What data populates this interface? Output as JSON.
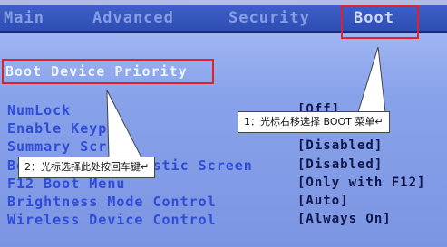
{
  "menubar": {
    "items": [
      {
        "label": "Main"
      },
      {
        "label": "Advanced"
      },
      {
        "label": "Security"
      },
      {
        "label": "Boot"
      }
    ]
  },
  "boot_device_priority": {
    "label": "Boot Device Priority"
  },
  "options": [
    {
      "label": "NumLock",
      "value": "[Off]"
    },
    {
      "label": "Enable Keypad",
      "value": ""
    },
    {
      "label": "Summary Screen",
      "value": "[Disabled]"
    },
    {
      "label": "Boot-time Diagnostic Screen",
      "value": "[Disabled]"
    },
    {
      "label": "F12 Boot Menu",
      "value": "[Only with F12]"
    },
    {
      "label": "Brightness Mode Control",
      "value": "[Auto]"
    },
    {
      "label": "Wireless Device Control",
      "value": "[Always On]"
    }
  ],
  "callouts": {
    "step1": "1：光标右移选择 BOOT 菜单↵",
    "step2": "2：光标选择此处按回车键↵"
  }
}
